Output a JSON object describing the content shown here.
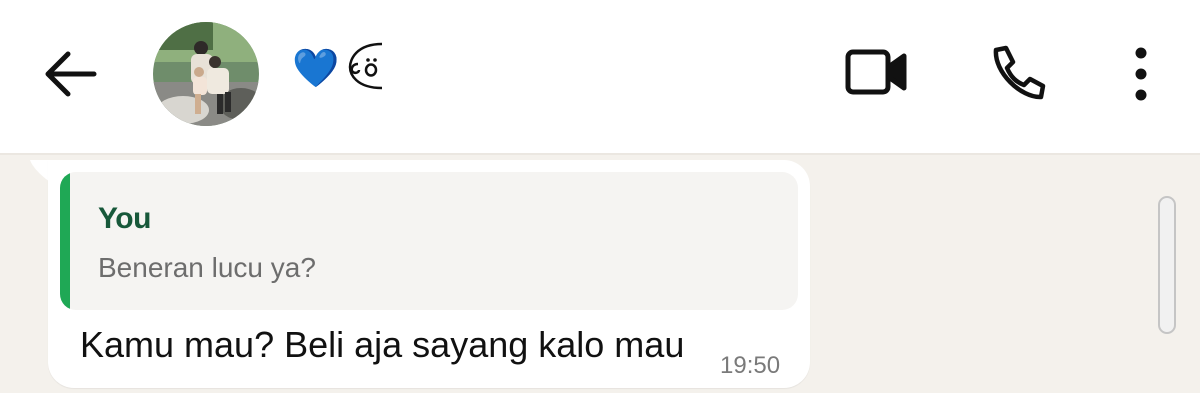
{
  "header": {
    "back_icon": "arrow-left-icon",
    "avatar_desc": "contact-avatar-photo",
    "contact_name": "💙",
    "contact_emoji_icon": "peeking-face-emoji",
    "video_icon": "video-camera-icon",
    "call_icon": "phone-icon",
    "menu_icon": "more-vertical-icon"
  },
  "message": {
    "quoted": {
      "author": "You",
      "text": "Beneran lucu ya?"
    },
    "text": "Kamu mau? Beli aja sayang kalo mau",
    "time": "19:50"
  },
  "colors": {
    "accent_green": "#1fa855",
    "author_green": "#17583a",
    "chat_background": "#f4f1ec"
  }
}
